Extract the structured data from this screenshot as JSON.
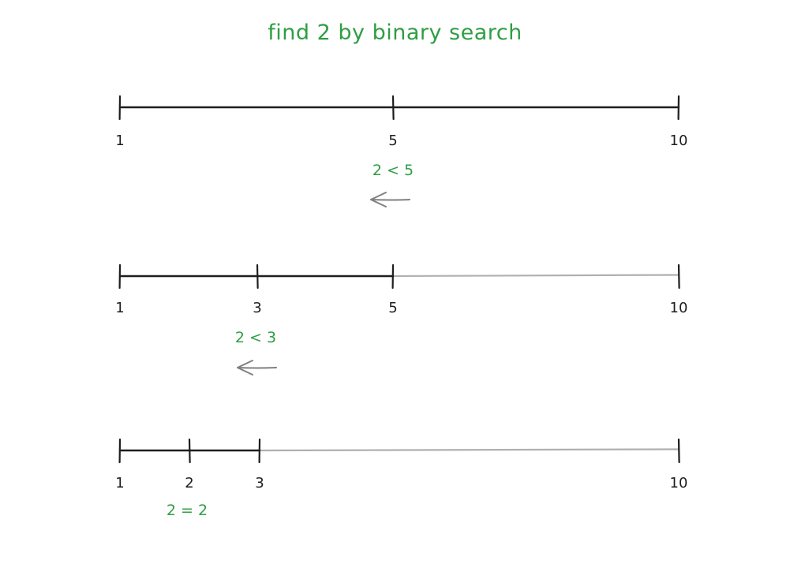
{
  "title": "find 2 by binary search",
  "colors": {
    "active": "#1e1e1e",
    "inactive": "#b0b0b0",
    "text_green": "#2f9e44",
    "arrow": "#808080"
  },
  "steps": [
    {
      "ticks": [
        {
          "label": "1",
          "value": 1
        },
        {
          "label": "5",
          "value": 5
        },
        {
          "label": "10",
          "value": 10
        }
      ],
      "active_range": [
        1,
        10
      ],
      "comparison": "2 < 5",
      "arrow": "left"
    },
    {
      "ticks": [
        {
          "label": "1",
          "value": 1
        },
        {
          "label": "3",
          "value": 3
        },
        {
          "label": "5",
          "value": 5
        },
        {
          "label": "10",
          "value": 10
        }
      ],
      "active_range": [
        1,
        5
      ],
      "comparison": "2 < 3",
      "arrow": "left"
    },
    {
      "ticks": [
        {
          "label": "1",
          "value": 1
        },
        {
          "label": "2",
          "value": 2
        },
        {
          "label": "3",
          "value": 3
        },
        {
          "label": "10",
          "value": 10
        }
      ],
      "active_range": [
        1,
        3
      ],
      "comparison": "2 = 2",
      "arrow": null
    }
  ]
}
